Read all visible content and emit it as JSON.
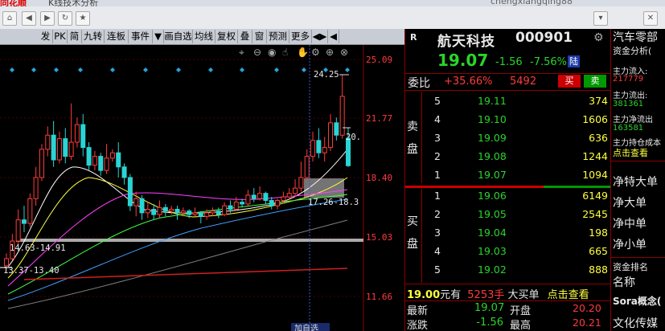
{
  "window": {
    "logo": "同花顺",
    "title": "K线技术分析",
    "user": "chengxiangqing88"
  },
  "toolbar": {
    "items": [
      "发",
      "PK",
      "简",
      "九转",
      "连板",
      "事件",
      "▼",
      "画自选",
      "均线",
      "复权",
      "叠",
      "窗",
      "预测",
      "更多",
      "◀▶",
      "◀"
    ]
  },
  "chart_icons": [
    "crosshair-icon",
    "zoom-out-icon",
    "eye-icon",
    "cursor-icon",
    "hand-icon",
    "settings-icon",
    "zoom-in-icon",
    "close-icon"
  ],
  "chart_data": {
    "type": "candlestick",
    "y_ticks": [
      "25.09",
      "21.77",
      "18.40",
      "15.03",
      "11.66"
    ],
    "annotations": {
      "high_marker": "24.25",
      "right_marker": "20.",
      "box1": "17.26-18.3",
      "box2": "14.63-14.91",
      "box3": "13.37-13.40",
      "cursor_label": "加自选"
    },
    "candles": [
      {
        "o": 13.4,
        "c": 13.8,
        "h": 14.1,
        "l": 13.2
      },
      {
        "o": 13.8,
        "c": 14.8,
        "h": 15.2,
        "l": 13.7
      },
      {
        "o": 14.8,
        "c": 16.0,
        "h": 16.6,
        "l": 14.6
      },
      {
        "o": 16.0,
        "c": 15.8,
        "h": 16.8,
        "l": 15.3
      },
      {
        "o": 15.8,
        "c": 17.2,
        "h": 17.5,
        "l": 15.6
      },
      {
        "o": 17.2,
        "c": 18.4,
        "h": 19.0,
        "l": 16.8
      },
      {
        "o": 18.4,
        "c": 20.0,
        "h": 20.3,
        "l": 18.2
      },
      {
        "o": 20.0,
        "c": 20.8,
        "h": 21.3,
        "l": 19.6
      },
      {
        "o": 20.8,
        "c": 19.4,
        "h": 21.6,
        "l": 19.0
      },
      {
        "o": 19.4,
        "c": 20.6,
        "h": 21.0,
        "l": 19.2
      },
      {
        "o": 20.6,
        "c": 19.6,
        "h": 21.2,
        "l": 19.2
      },
      {
        "o": 19.6,
        "c": 20.4,
        "h": 22.6,
        "l": 19.4
      },
      {
        "o": 20.4,
        "c": 21.4,
        "h": 21.8,
        "l": 20.1
      },
      {
        "o": 21.4,
        "c": 20.1,
        "h": 22.0,
        "l": 19.6
      },
      {
        "o": 20.1,
        "c": 19.1,
        "h": 20.4,
        "l": 18.8
      },
      {
        "o": 19.1,
        "c": 19.6,
        "h": 19.9,
        "l": 18.8
      },
      {
        "o": 19.6,
        "c": 18.8,
        "h": 19.8,
        "l": 18.5
      },
      {
        "o": 18.8,
        "c": 19.5,
        "h": 20.3,
        "l": 18.6
      },
      {
        "o": 19.5,
        "c": 19.8,
        "h": 20.0,
        "l": 19.3
      },
      {
        "o": 19.8,
        "c": 19.0,
        "h": 20.4,
        "l": 18.4
      },
      {
        "o": 19.0,
        "c": 18.4,
        "h": 19.2,
        "l": 18.0
      },
      {
        "o": 18.4,
        "c": 16.8,
        "h": 18.6,
        "l": 16.5
      },
      {
        "o": 16.8,
        "c": 17.2,
        "h": 17.6,
        "l": 16.2
      },
      {
        "o": 17.2,
        "c": 16.4,
        "h": 17.4,
        "l": 16.0
      },
      {
        "o": 16.4,
        "c": 16.6,
        "h": 17.0,
        "l": 16.1
      },
      {
        "o": 16.6,
        "c": 16.3,
        "h": 16.9,
        "l": 16.0
      },
      {
        "o": 16.3,
        "c": 16.7,
        "h": 17.1,
        "l": 16.1
      },
      {
        "o": 16.7,
        "c": 16.5,
        "h": 16.9,
        "l": 16.2
      },
      {
        "o": 16.5,
        "c": 16.6,
        "h": 16.8,
        "l": 16.3
      },
      {
        "o": 16.6,
        "c": 16.4,
        "h": 16.8,
        "l": 16.0
      },
      {
        "o": 16.4,
        "c": 16.5,
        "h": 16.7,
        "l": 16.2
      },
      {
        "o": 16.5,
        "c": 16.3,
        "h": 16.6,
        "l": 16.1
      },
      {
        "o": 16.3,
        "c": 16.4,
        "h": 16.7,
        "l": 16.2
      },
      {
        "o": 16.4,
        "c": 16.2,
        "h": 16.5,
        "l": 15.8
      },
      {
        "o": 16.2,
        "c": 16.4,
        "h": 16.6,
        "l": 16.0
      },
      {
        "o": 16.4,
        "c": 16.5,
        "h": 16.7,
        "l": 16.2
      },
      {
        "o": 16.5,
        "c": 16.3,
        "h": 16.7,
        "l": 16.1
      },
      {
        "o": 16.3,
        "c": 16.8,
        "h": 17.0,
        "l": 16.2
      },
      {
        "o": 16.8,
        "c": 16.6,
        "h": 17.1,
        "l": 16.4
      },
      {
        "o": 16.6,
        "c": 17.0,
        "h": 17.3,
        "l": 16.5
      },
      {
        "o": 17.0,
        "c": 16.9,
        "h": 17.2,
        "l": 16.7
      },
      {
        "o": 16.9,
        "c": 17.4,
        "h": 17.7,
        "l": 16.8
      },
      {
        "o": 17.4,
        "c": 17.2,
        "h": 17.8,
        "l": 17.0
      },
      {
        "o": 17.2,
        "c": 17.5,
        "h": 17.9,
        "l": 17.1
      },
      {
        "o": 17.5,
        "c": 17.1,
        "h": 17.6,
        "l": 16.9
      },
      {
        "o": 17.1,
        "c": 16.8,
        "h": 17.3,
        "l": 16.6
      },
      {
        "o": 16.8,
        "c": 17.1,
        "h": 17.2,
        "l": 16.6
      },
      {
        "o": 17.1,
        "c": 17.3,
        "h": 17.6,
        "l": 17.0
      },
      {
        "o": 17.3,
        "c": 17.5,
        "h": 17.8,
        "l": 17.1
      },
      {
        "o": 17.5,
        "c": 17.8,
        "h": 18.3,
        "l": 17.3
      },
      {
        "o": 17.8,
        "c": 18.4,
        "h": 19.3,
        "l": 17.6
      },
      {
        "o": 18.4,
        "c": 19.6,
        "h": 20.0,
        "l": 18.3
      },
      {
        "o": 19.6,
        "c": 20.5,
        "h": 21.0,
        "l": 19.3
      },
      {
        "o": 20.5,
        "c": 19.8,
        "h": 21.2,
        "l": 19.5
      },
      {
        "o": 19.8,
        "c": 20.1,
        "h": 20.7,
        "l": 19.3
      },
      {
        "o": 20.1,
        "c": 21.5,
        "h": 22.0,
        "l": 19.9
      },
      {
        "o": 21.5,
        "c": 20.8,
        "h": 21.8,
        "l": 20.5
      },
      {
        "o": 20.8,
        "c": 23.0,
        "h": 24.25,
        "l": 20.6
      },
      {
        "o": 20.63,
        "c": 19.07,
        "h": 21.2,
        "l": 19.0
      }
    ]
  },
  "quote": {
    "r": "R",
    "name": "航天科技",
    "code": "000901",
    "price": "19.07",
    "change": "-1.56",
    "change_pct": "-7.56%",
    "exchange": "陆",
    "weibi_label": "委比",
    "weibi_value": "+35.66%",
    "weicha": "5492",
    "buy_btn": "买",
    "sell_btn": "卖",
    "sell_label": [
      "卖",
      "盘"
    ],
    "buy_label": [
      "买",
      "盘"
    ],
    "asks": [
      {
        "lvl": "5",
        "price": "19.11",
        "vol": "374"
      },
      {
        "lvl": "4",
        "price": "19.10",
        "vol": "1606"
      },
      {
        "lvl": "3",
        "price": "19.09",
        "vol": "636"
      },
      {
        "lvl": "2",
        "price": "19.08",
        "vol": "1244"
      },
      {
        "lvl": "1",
        "price": "19.07",
        "vol": "1094"
      }
    ],
    "bids": [
      {
        "lvl": "1",
        "price": "19.06",
        "vol": "6149"
      },
      {
        "lvl": "2",
        "price": "19.05",
        "vol": "2545"
      },
      {
        "lvl": "3",
        "price": "19.04",
        "vol": "198"
      },
      {
        "lvl": "4",
        "price": "19.03",
        "vol": "665"
      },
      {
        "lvl": "5",
        "price": "19.02",
        "vol": "888"
      }
    ],
    "bigorder_price": "19.00",
    "bigorder_unit": "元有",
    "bigorder_vol": "5253手",
    "bigorder_label": "大买单",
    "bigorder_link": "点击查看",
    "stats": [
      {
        "k1": "最新",
        "v1": "19.07",
        "k2": "开盘",
        "v2": "20.20"
      },
      {
        "k1": "涨跌",
        "v1": "-1.56",
        "k2": "最高",
        "v2": "20.21"
      }
    ]
  },
  "fund": {
    "sector": "汽车零部",
    "title": "资金分析(",
    "inflow_label": "主力流入:",
    "inflow": "217779",
    "outflow_label": "主力流出:",
    "outflow": "381361",
    "net_label": "主力净流出",
    "net": "163581",
    "cost_label": "主力持仓成本",
    "click": "点击查看",
    "size_labels": [
      "净特大单",
      "净大单",
      "净中单",
      "净小单"
    ],
    "rank_title": "资金排名",
    "rank_col": "名称",
    "rank_items": [
      "Sora概念(",
      "文化传媒"
    ]
  }
}
